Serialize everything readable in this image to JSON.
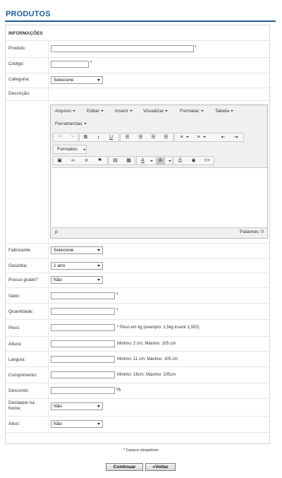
{
  "page": {
    "title": "PRODUTOS",
    "section": "INFORMAÇÕES"
  },
  "fields": {
    "produto": {
      "label": "Produto:",
      "value": "",
      "required": "*"
    },
    "codigo": {
      "label": "Código:",
      "value": "",
      "required": "*"
    },
    "categoria": {
      "label": "Categoria:",
      "selected": "Selecione"
    },
    "descricao": {
      "label": "Descrição:"
    },
    "fabricante": {
      "label": "Fabricante:",
      "selected": "Selecione"
    },
    "garantia": {
      "label": "Garantia:",
      "selected": "1 ano"
    },
    "possui_grade": {
      "label": "Possui grade?",
      "selected": "Não"
    },
    "valor": {
      "label": "Valor:",
      "value": "",
      "required": "*"
    },
    "quantidade": {
      "label": "Quantidade:",
      "value": "",
      "required": "*"
    },
    "peso": {
      "label": "Peso:",
      "value": "",
      "hint": "* Peso em kg (exemplo: 1,5kg inserir 1,500)"
    },
    "altura": {
      "label": "Altura:",
      "value": "",
      "hint": "Mínimo: 2 cm; Máximo: 105 cm"
    },
    "largura": {
      "label": "Largura:",
      "value": "",
      "hint": "Mínimo: 11 cm; Máximo: 105 cm"
    },
    "comprimento": {
      "label": "Comprimento:",
      "value": "",
      "hint": "Mínimo: 16cm; Máximo: 105cm"
    },
    "desconto": {
      "label": "Desconto:",
      "value": "",
      "unit": "%"
    },
    "destaque": {
      "label_line1": "Destaque na",
      "label_line2": "home:",
      "selected": "Não"
    },
    "ativo": {
      "label": "Ativo:",
      "selected": "Não"
    }
  },
  "editor": {
    "menus": [
      "Arquivo",
      "Editar",
      "Inserir",
      "Visualizar",
      "Formatar",
      "Tabela",
      "Ferramentas"
    ],
    "formats_label": "Formatos",
    "status_path": "p",
    "word_count": "Palavras: 0",
    "icons_row1": [
      "undo-icon",
      "redo-icon",
      "bold-icon",
      "italic-icon",
      "underline-icon",
      "align-left-icon",
      "align-center-icon",
      "align-right-icon",
      "align-justify-icon",
      "bullet-list-icon",
      "numbered-list-icon",
      "outdent-icon",
      "indent-icon"
    ],
    "icons_row2": [
      "paste-icon",
      "link-icon",
      "unlink-icon",
      "anchor-icon",
      "image-icon",
      "media-icon",
      "text-color-icon",
      "background-color-icon",
      "print-icon",
      "preview-icon",
      "code-icon"
    ]
  },
  "footer": {
    "note": "* Campos obrigatórios",
    "continue_label": "Continuar",
    "back_label": "«Voltar"
  },
  "colors": {
    "title": "#1f5c99",
    "border": "#9a9a9a"
  }
}
